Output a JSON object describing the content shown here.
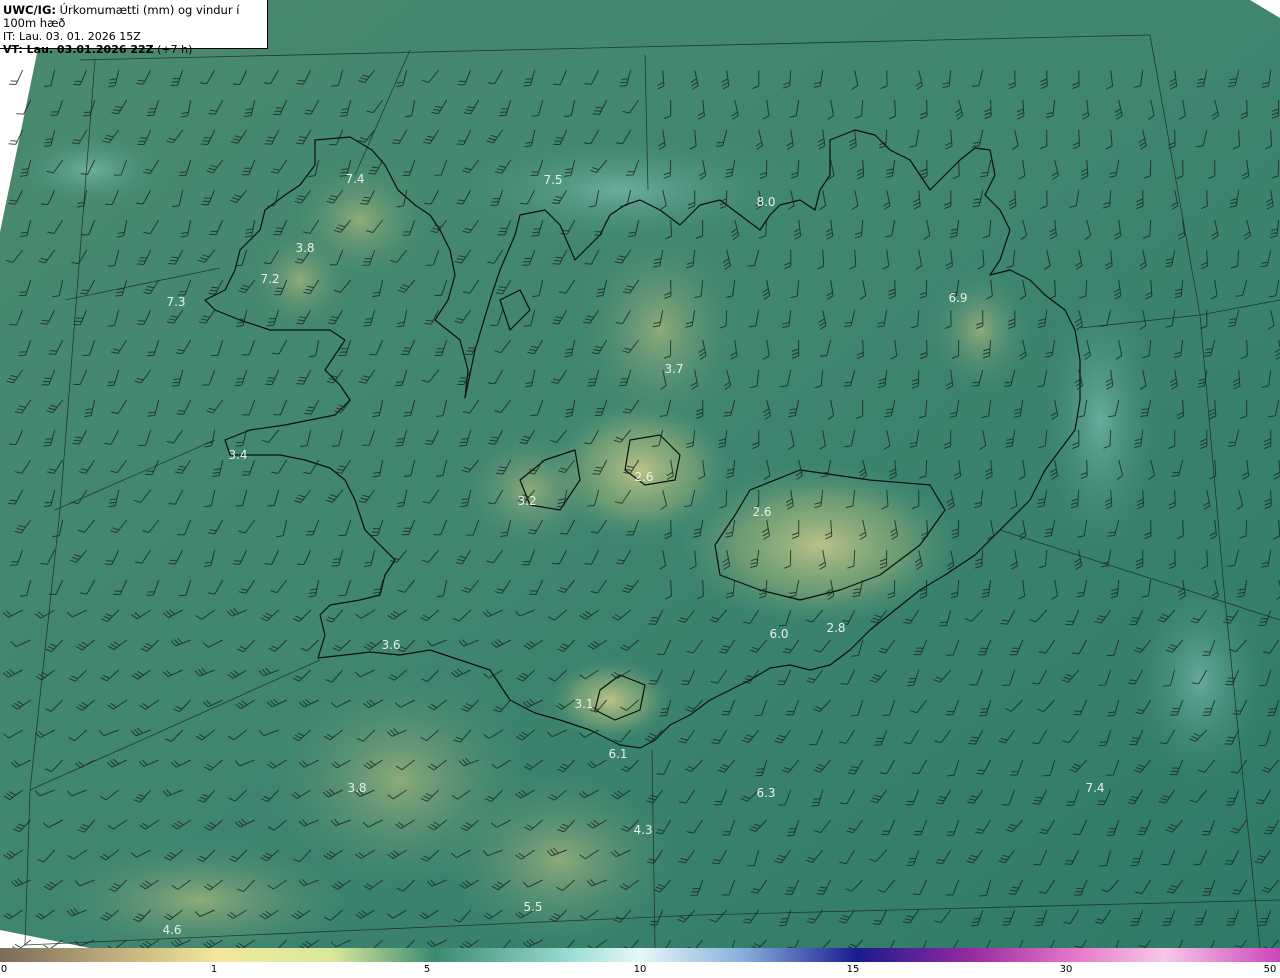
{
  "header": {
    "model": "UWC/IG:",
    "title": "Úrkomumætti (mm) og vindur í 100m hæð",
    "issue_time": "IT: Lau. 03. 01. 2026 15Z",
    "valid_prefix": "VT: Lau. 03.01.2026 22Z",
    "valid_lead": "(+7 h)"
  },
  "map_values": [
    "7.4",
    "7.5",
    "8.0",
    "3.8",
    "7.2",
    "7.3",
    "6.9",
    "3.7",
    "3.4",
    "2.6",
    "3.2",
    "2.6",
    "6.0",
    "2.8",
    "3.6",
    "3.1",
    "6.1",
    "3.8",
    "6.3",
    "7.4",
    "4.3",
    "5.5",
    "4.6"
  ],
  "colorbar": {
    "ticks": [
      "0",
      "1",
      "5",
      "10",
      "15",
      "30",
      "50"
    ],
    "colors": [
      "#7a6a5a",
      "#b8a878",
      "#f2e89a",
      "#d9e89a",
      "#3a8a70",
      "#9fe0d8",
      "#e6f7f8",
      "#88b0dc",
      "#1a1a90",
      "#9a2aa0",
      "#e678c8",
      "#f7c8e8",
      "#cc44bb"
    ]
  }
}
